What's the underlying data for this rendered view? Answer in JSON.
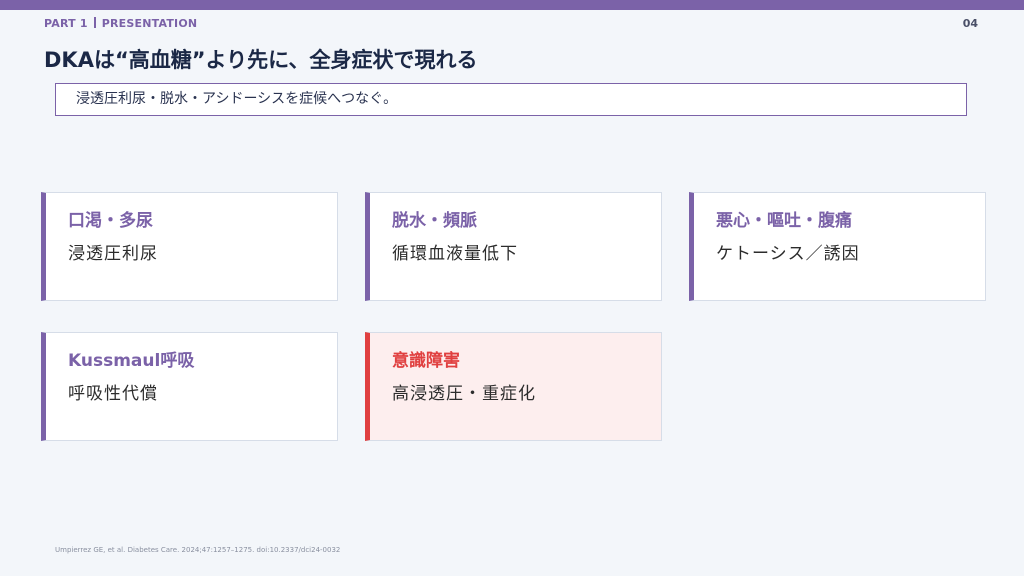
{
  "header": {
    "part": "PART 1",
    "section": "PRESENTATION",
    "page_number": "04"
  },
  "title": "DKAは“高血糖”より先に、全身症状で現れる",
  "subtitle": "浸透圧利尿・脱水・アシドーシスを症候へつなぐ。",
  "cards": [
    {
      "heading": "口渇・多尿",
      "body": "浸透圧利尿"
    },
    {
      "heading": "脱水・頻脈",
      "body": "循環血液量低下"
    },
    {
      "heading": "悪心・嘔吐・腹痛",
      "body": "ケトーシス／誘因"
    },
    {
      "heading": "Kussmaul呼吸",
      "body": "呼吸性代償"
    },
    {
      "heading": "意識障害",
      "body": "高浸透圧・重症化"
    }
  ],
  "colors": {
    "accent": "#7b62a8",
    "alert": "#e04040",
    "alert_bg": "#fdeeee",
    "background": "#f3f6fa"
  },
  "footnote": "Umpierrez GE, et al. Diabetes Care. 2024;47:1257–1275. doi:10.2337/dci24-0032"
}
